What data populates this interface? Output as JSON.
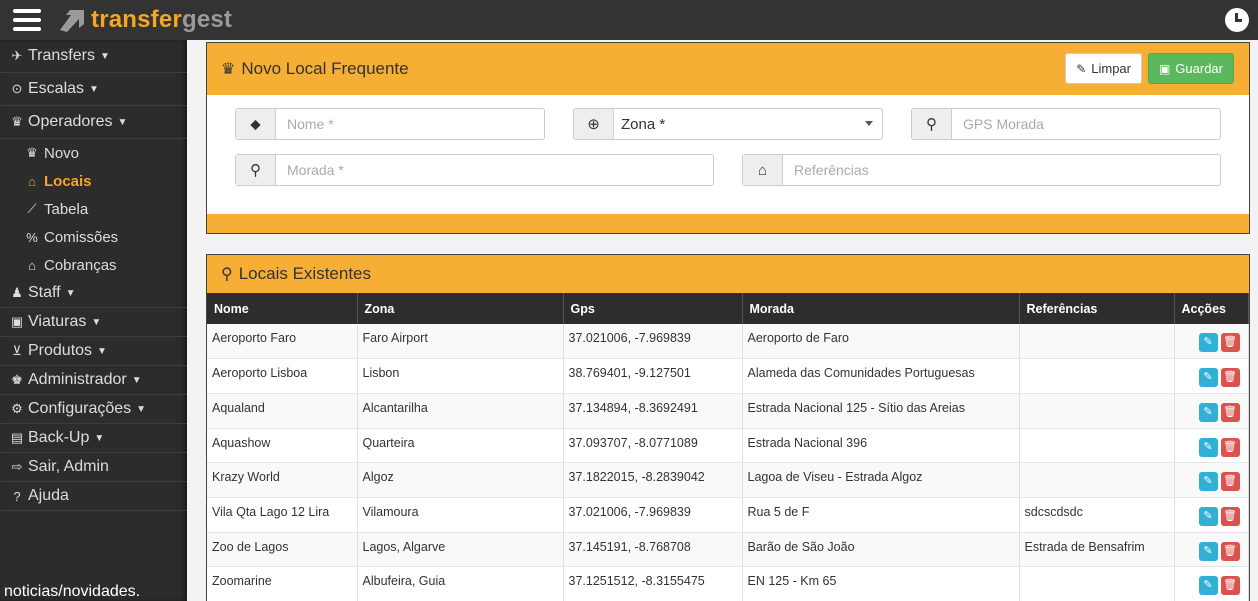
{
  "app": {
    "brand_part1": "transfer",
    "brand_part2": "gest"
  },
  "sidebar": {
    "items": [
      {
        "label": "Transfers",
        "icon": "plane-icon"
      },
      {
        "label": "Escalas",
        "icon": "clock-icon"
      },
      {
        "label": "Operadores",
        "icon": "crown-icon"
      },
      {
        "label": "Staff",
        "icon": "user-icon"
      },
      {
        "label": "Viaturas",
        "icon": "car-icon"
      },
      {
        "label": "Produtos",
        "icon": "cart-icon"
      },
      {
        "label": "Administrador",
        "icon": "admin-icon"
      },
      {
        "label": "Configurações",
        "icon": "gear-icon"
      },
      {
        "label": "Back-Up",
        "icon": "backup-icon"
      },
      {
        "label": "Sair, Admin",
        "icon": "signout-icon"
      },
      {
        "label": "Ajuda",
        "icon": "question-icon"
      }
    ],
    "sub": [
      {
        "label": "Novo"
      },
      {
        "label": "Locais"
      },
      {
        "label": "Tabela"
      },
      {
        "label": "Comissões"
      },
      {
        "label": "Cobranças"
      }
    ],
    "news": "noticias/novidades."
  },
  "form": {
    "title": "Novo Local Frequente",
    "limpar_label": "Limpar",
    "guardar_label": "Guardar",
    "nome_placeholder": "Nome *",
    "zona_value": "Zona *",
    "gps_placeholder": "GPS Morada",
    "morada_placeholder": "Morada *",
    "referencias_placeholder": "Referências"
  },
  "list": {
    "title": "Locais Existentes",
    "columns": [
      "Nome",
      "Zona",
      "Gps",
      "Morada",
      "Referências",
      "Acções"
    ],
    "rows": [
      {
        "nome": "Aeroporto Faro",
        "zona": "Faro Airport",
        "gps": "37.021006, -7.969839",
        "morada": "Aeroporto de Faro",
        "ref": ""
      },
      {
        "nome": "Aeroporto Lisboa",
        "zona": "Lisbon",
        "gps": "38.769401, -9.127501",
        "morada": "Alameda das Comunidades Portuguesas",
        "ref": ""
      },
      {
        "nome": "Aqualand",
        "zona": "Alcantarilha",
        "gps": "37.134894, -8.3692491",
        "morada": "Estrada Nacional 125 - Sítio das Areias",
        "ref": ""
      },
      {
        "nome": "Aquashow",
        "zona": "Quarteira",
        "gps": "37.093707, -8.0771089",
        "morada": "Estrada Nacional 396",
        "ref": ""
      },
      {
        "nome": "Krazy World",
        "zona": "Algoz",
        "gps": "37.1822015, -8.2839042",
        "morada": "Lagoa de Viseu - Estrada Algoz",
        "ref": ""
      },
      {
        "nome": "Vila Qta Lago 12 Lira",
        "zona": "Vilamoura",
        "gps": "37.021006, -7.969839",
        "morada": "Rua 5 de F",
        "ref": "sdcscdsdc"
      },
      {
        "nome": "Zoo de Lagos",
        "zona": "Lagos, Algarve",
        "gps": "37.145191, -8.768708",
        "morada": "Barão de São João",
        "ref": "Estrada de Bensafrim"
      },
      {
        "nome": "Zoomarine",
        "zona": "Albufeira, Guia",
        "gps": "37.1251512, -8.3155475",
        "morada": "EN 125 - Km 65",
        "ref": ""
      }
    ]
  },
  "colors": {
    "accent": "#f7ae35",
    "brand": "#f5a623",
    "dark": "#2d2d2d",
    "save": "#5cb85c",
    "edit": "#31b0d5",
    "delete": "#d9534f"
  }
}
